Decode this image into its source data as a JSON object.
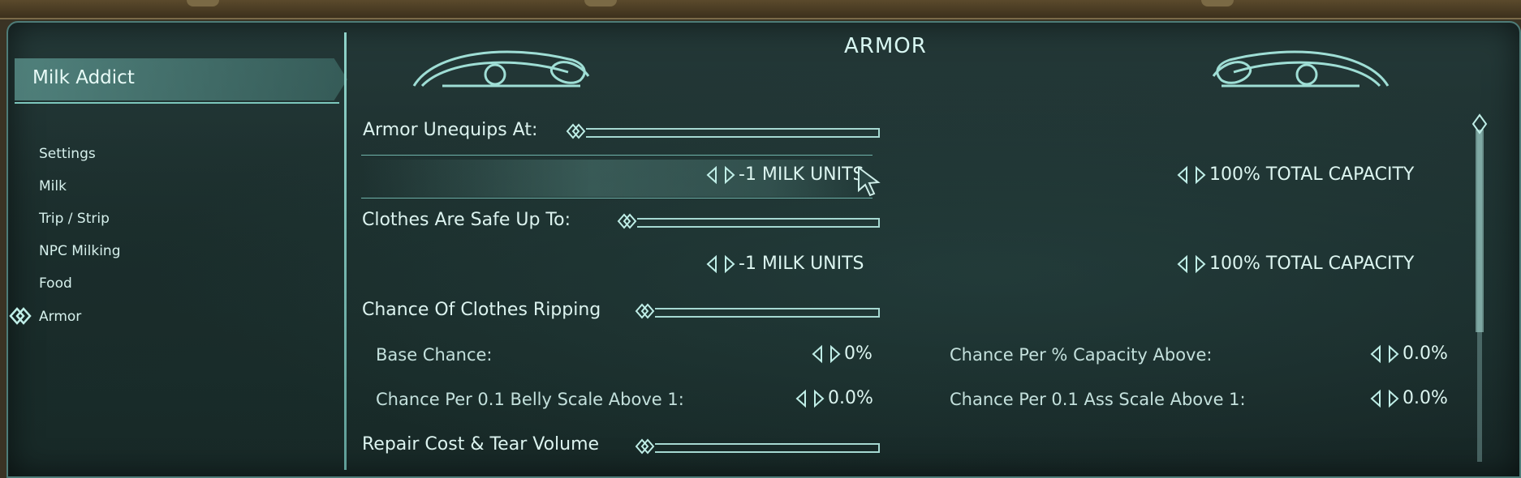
{
  "app": {
    "mod_name": "Milk Addict"
  },
  "menu": {
    "items": [
      {
        "label": "Settings"
      },
      {
        "label": "Milk"
      },
      {
        "label": "Trip / Strip"
      },
      {
        "label": "NPC Milking"
      },
      {
        "label": "Food"
      },
      {
        "label": "Armor",
        "selected": true
      }
    ]
  },
  "page": {
    "title": "ARMOR",
    "armor_unequips": {
      "label": "Armor Unequips At:",
      "left_value": "-1 MILK UNITS",
      "right_value": "100% TOTAL CAPACITY"
    },
    "clothes_safe": {
      "label": "Clothes Are Safe Up To:",
      "left_value": "-1 MILK UNITS",
      "right_value": "100% TOTAL CAPACITY"
    },
    "clothes_ripping": {
      "label": "Chance Of Clothes Ripping",
      "base_chance_label": "Base Chance:",
      "base_chance_value": "0%",
      "per_capacity_label": "Chance Per % Capacity Above:",
      "per_capacity_value": "0.0%",
      "per_belly_label": "Chance Per 0.1 Belly Scale Above 1:",
      "per_belly_value": "0.0%",
      "per_ass_label": "Chance Per 0.1 Ass Scale Above 1:",
      "per_ass_value": "0.0%"
    },
    "repair": {
      "label": "Repair Cost & Tear Volume"
    }
  },
  "colors": {
    "accent": "#8fd3c9",
    "panel_bg": "#1f3333",
    "text": "#dcf3ef"
  },
  "icons": {
    "menu_cursor": "celtic-knot-cursor-icon",
    "slider_knob": "diamond-knot-icon",
    "value_arrow": "left-right-arrows-icon",
    "mouse_pointer": "mouse-pointer-icon"
  }
}
